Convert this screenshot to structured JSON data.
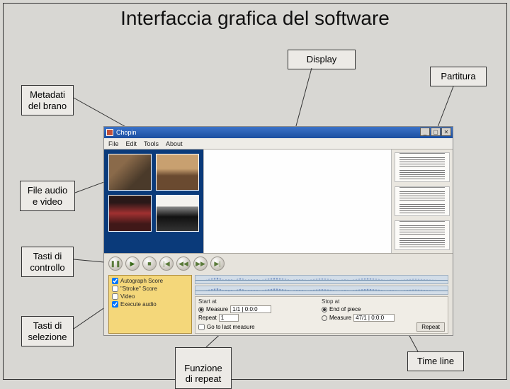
{
  "title": "Interfaccia grafica del software",
  "labels": {
    "display": "Display",
    "partitura": "Partitura",
    "metadati": "Metadati\ndel brano",
    "file_av": "File audio\ne video",
    "tasti_ctrl": "Tasti di\ncontrollo",
    "tasti_sel": "Tasti di\nselezione",
    "funzione_repeat": "Funzione\ndi repeat",
    "timeline": "Time line"
  },
  "app": {
    "title": "Chopin",
    "menus": [
      "File",
      "Edit",
      "Tools",
      "About"
    ],
    "checks": [
      {
        "label": "Autograph Score",
        "checked": true
      },
      {
        "label": "\"Stroke\" Score",
        "checked": false
      },
      {
        "label": "Video",
        "checked": false
      },
      {
        "label": "Execute audio",
        "checked": true
      }
    ],
    "controls": {
      "buttons": [
        "pause",
        "play",
        "stop",
        "prev",
        "rew",
        "fwd",
        "next"
      ]
    },
    "repeat": {
      "start_header": "Start at",
      "stop_header": "Stop at",
      "measure_label": "Measure",
      "measure_start": "1/1 | 0:0:0",
      "end_of_piece_label": "End of piece",
      "measure_stop": "47/1 | 0:0:0",
      "repeat_label": "Repeat",
      "repeat_value": "1",
      "last_measures_label": "Go to last measure",
      "repeat_btn": "Repeat"
    }
  }
}
